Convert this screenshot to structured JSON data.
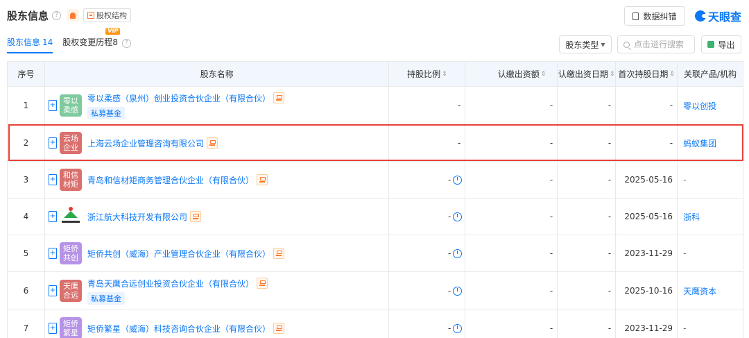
{
  "header": {
    "title": "股东信息",
    "equity_label": "股权结构",
    "correct_label": "数据纠错",
    "logo_text": "天眼查"
  },
  "tabs": [
    {
      "label": "股东信息",
      "count": "14"
    },
    {
      "label": "股权变更历程",
      "count": "8",
      "badge": "VIP"
    }
  ],
  "toolbar": {
    "type_select": "股东类型",
    "search_placeholder": "点击进行搜索",
    "export_label": "导出"
  },
  "columns": [
    "序号",
    "股东名称",
    "持股比例",
    "认缴出资额",
    "认缴出资日期",
    "首次持股日期",
    "关联产品/机构"
  ],
  "rows": [
    {
      "index": "1",
      "avatar": "零以柔感",
      "avatar_color": "#7fc99e",
      "name": "零以柔感（泉州）创业投资合伙企业（有限合伙）",
      "tag": "私募基金",
      "ratio": "-",
      "amount": "-",
      "sub_date": "-",
      "first_date": "-",
      "related": "零以创投"
    },
    {
      "index": "2",
      "avatar": "云场企业",
      "avatar_color": "#d9706d",
      "name": "上海云场企业管理咨询有限公司",
      "tag": "",
      "ratio": "-",
      "amount": "-",
      "sub_date": "-",
      "first_date": "-",
      "related": "蚂蚁集团"
    },
    {
      "index": "3",
      "avatar": "和信材矩",
      "avatar_color": "#d9706d",
      "name": "青岛和信材矩商务管理合伙企业（有限合伙）",
      "tag": "",
      "ratio": "-",
      "amount": "-",
      "sub_date": "-",
      "first_date": "2025-05-16",
      "related": "-"
    },
    {
      "index": "4",
      "avatar": "",
      "avatar_color": "#ffffff",
      "name": "浙江航大科技开发有限公司",
      "tag": "",
      "ratio": "-",
      "amount": "-",
      "sub_date": "-",
      "first_date": "2025-05-16",
      "related": "浙科"
    },
    {
      "index": "5",
      "avatar": "矩侨共创",
      "avatar_color": "#b693e6",
      "name": "矩侨共创（威海）产业管理合伙企业（有限合伙）",
      "tag": "",
      "ratio": "-",
      "amount": "-",
      "sub_date": "-",
      "first_date": "2023-11-29",
      "related": "-"
    },
    {
      "index": "6",
      "avatar": "天鹰合远",
      "avatar_color": "#d9706d",
      "name": "青岛天鹰合远创业投资合伙企业（有限合伙）",
      "tag": "私募基金",
      "ratio": "-",
      "amount": "-",
      "sub_date": "-",
      "first_date": "2025-10-16",
      "related": "天鹰资本"
    },
    {
      "index": "7",
      "avatar": "矩侨繁星",
      "avatar_color": "#b693e6",
      "name": "矩侨繁星（威海）科技咨询合伙企业（有限合伙）",
      "tag": "",
      "ratio": "-",
      "amount": "-",
      "sub_date": "-",
      "first_date": "2023-11-29",
      "related": "-"
    }
  ]
}
